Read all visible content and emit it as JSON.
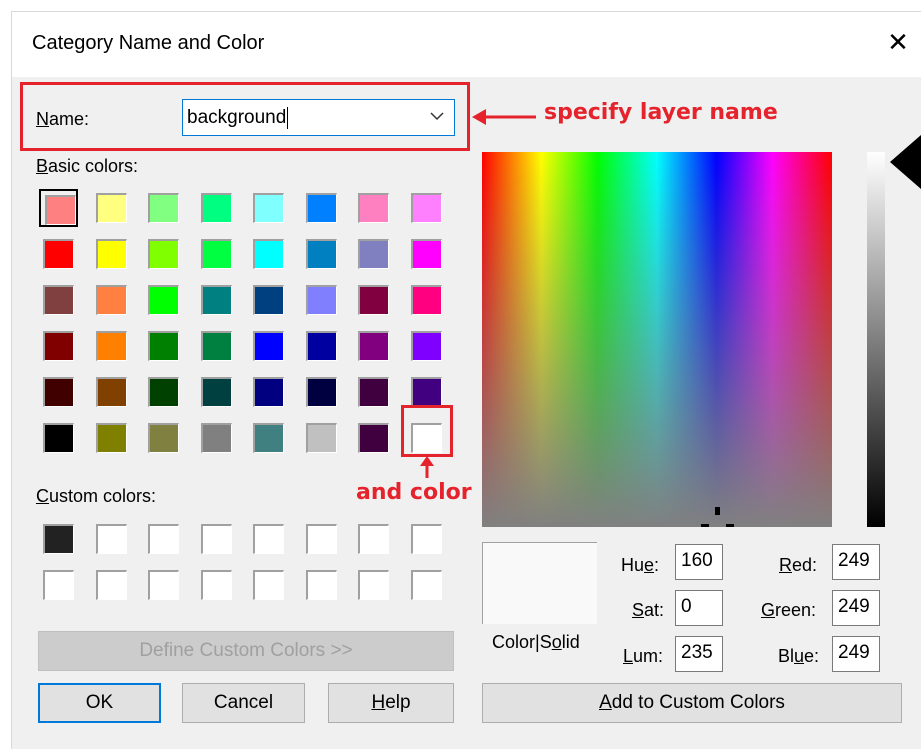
{
  "dialog": {
    "title": "Category Name and Color",
    "close": "✕"
  },
  "name": {
    "label_u": "N",
    "label_rest": "ame:",
    "value": "background"
  },
  "basic_colors": {
    "label_u": "B",
    "label_rest": "asic colors:",
    "rows": [
      [
        "#ff8080",
        "#ffff80",
        "#80ff80",
        "#00ff80",
        "#80ffff",
        "#0080ff",
        "#ff80c0",
        "#ff80ff"
      ],
      [
        "#ff0000",
        "#ffff00",
        "#80ff00",
        "#00ff40",
        "#00ffff",
        "#0080c0",
        "#8080c0",
        "#ff00ff"
      ],
      [
        "#804040",
        "#ff8040",
        "#00ff00",
        "#008080",
        "#004080",
        "#8080ff",
        "#800040",
        "#ff0080"
      ],
      [
        "#800000",
        "#ff8000",
        "#008000",
        "#008040",
        "#0000ff",
        "#0000a0",
        "#800080",
        "#8000ff"
      ],
      [
        "#400000",
        "#804000",
        "#004000",
        "#004040",
        "#000080",
        "#000040",
        "#400040",
        "#400080"
      ],
      [
        "#000000",
        "#808000",
        "#808040",
        "#808080",
        "#408080",
        "#c0c0c0",
        "#400040",
        "#ffffff"
      ]
    ]
  },
  "custom_colors": {
    "label_u": "C",
    "label_rest": "ustom colors:",
    "rows": [
      [
        "#222222",
        "#ffffff",
        "#ffffff",
        "#ffffff",
        "#ffffff",
        "#ffffff",
        "#ffffff",
        "#ffffff"
      ],
      [
        "#ffffff",
        "#ffffff",
        "#ffffff",
        "#ffffff",
        "#ffffff",
        "#ffffff",
        "#ffffff",
        "#ffffff"
      ]
    ]
  },
  "annotations": {
    "layer": "specify layer name",
    "color": "and color",
    "color_hex": "#e5232d"
  },
  "values": {
    "hue_label_pre": "Hu",
    "hue_label_u": "e",
    "hue_label_post": ":",
    "hue": "160",
    "sat_label_u": "S",
    "sat_label_rest": "at:",
    "sat": "0",
    "lum_label_u": "L",
    "lum_label_rest": "um:",
    "lum": "235",
    "red_label_u": "R",
    "red_label_rest": "ed:",
    "red": "249",
    "green_label_u": "G",
    "green_label_rest": "reen:",
    "green": "249",
    "blue_label_pre": "Bl",
    "blue_label_u": "u",
    "blue_label_post": "e:",
    "blue": "249"
  },
  "preview": {
    "label_pre": "Color|S",
    "label_u": "o",
    "label_post": "lid",
    "color": "#f9f9f9"
  },
  "buttons": {
    "define_custom": "Define Custom Colors >>",
    "ok": "OK",
    "cancel": "Cancel",
    "help_u": "H",
    "help_rest": "elp",
    "add_custom_u": "A",
    "add_custom_rest": "dd to Custom Colors"
  }
}
